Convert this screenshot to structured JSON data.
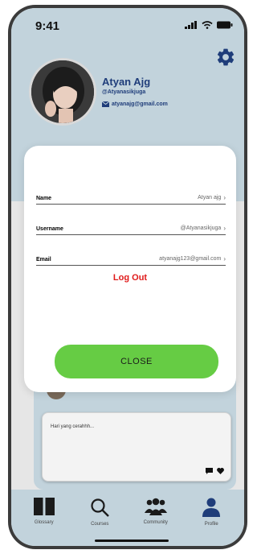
{
  "status_bar": {
    "time": "9:41"
  },
  "profile": {
    "name": "Atyan Ajg",
    "handle": "@Atyanasikjuga",
    "email": "atyanajg@gmail.com"
  },
  "modal": {
    "fields": [
      {
        "label": "Name",
        "value": "Atyan ajg"
      },
      {
        "label": "Username",
        "value": "@Atyanasikjuga"
      },
      {
        "label": "Email",
        "value": "atyanajg123@gmail.com"
      }
    ],
    "logout_label": "Log Out",
    "close_label": "CLOSE"
  },
  "post": {
    "text": "Hari yang cerahhh..."
  },
  "tabs": [
    {
      "label": "Glossary",
      "icon": "book-icon"
    },
    {
      "label": "Courses",
      "icon": "search-icon"
    },
    {
      "label": "Community",
      "icon": "people-icon"
    },
    {
      "label": "Profile",
      "icon": "person-icon"
    }
  ],
  "colors": {
    "accent_blue": "#1f3d7a",
    "profile_bg": "#c2d3dc",
    "close_button": "#66cc44",
    "logout_red": "#e01a1a"
  }
}
